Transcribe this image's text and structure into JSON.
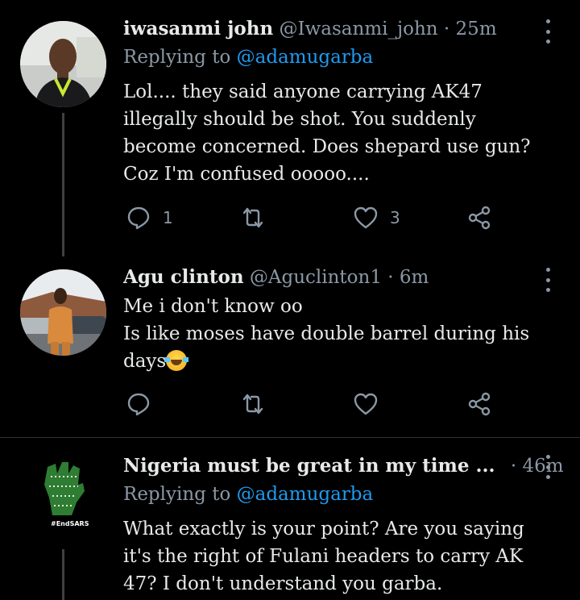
{
  "tweets": [
    {
      "name": "iwasanmi john",
      "handle": "@Iwasanmi_john",
      "time": "25m",
      "replying_prefix": "Replying to",
      "replying_to": "@adamugarba",
      "lines": [
        "Lol.... they said  anyone  carrying  AK47",
        "illegally  should  be shot. You suddenly",
        "become  concerned.  Does shepard use gun?",
        "Coz I'm confused  ooooo...."
      ],
      "actions": {
        "reply_count": "1",
        "retweet_count": "",
        "like_count": "3"
      },
      "avatar_icon": "profile-photo-man-glasses"
    },
    {
      "name": "Agu clinton",
      "handle": "@Aguclinton1",
      "time": "6m",
      "lines": [
        "Me i don't know oo",
        "Is like moses have double barrel during his",
        "days"
      ],
      "emoji": "face-with-tears-of-joy",
      "actions": {
        "reply_count": "",
        "retweet_count": "",
        "like_count": ""
      },
      "avatar_icon": "profile-photo-man-standing"
    },
    {
      "name": "Nigeria must be great in my time ...",
      "handle": "",
      "time": "46m",
      "replying_prefix": "Replying to",
      "replying_to": "@adamugarba",
      "lines": [
        "What exactly is your point? Are you saying",
        "it's the right of Fulani headers to carry AK",
        "47? I don't understand you garba."
      ],
      "avatar_text": "#EndSARS",
      "avatar_icon": "raised-fist-logo"
    }
  ],
  "colors": {
    "background": "#000000",
    "text": "#e7e9ea",
    "muted": "#8b98a5",
    "link": "#1d9bf0",
    "divider": "#2f3336"
  }
}
